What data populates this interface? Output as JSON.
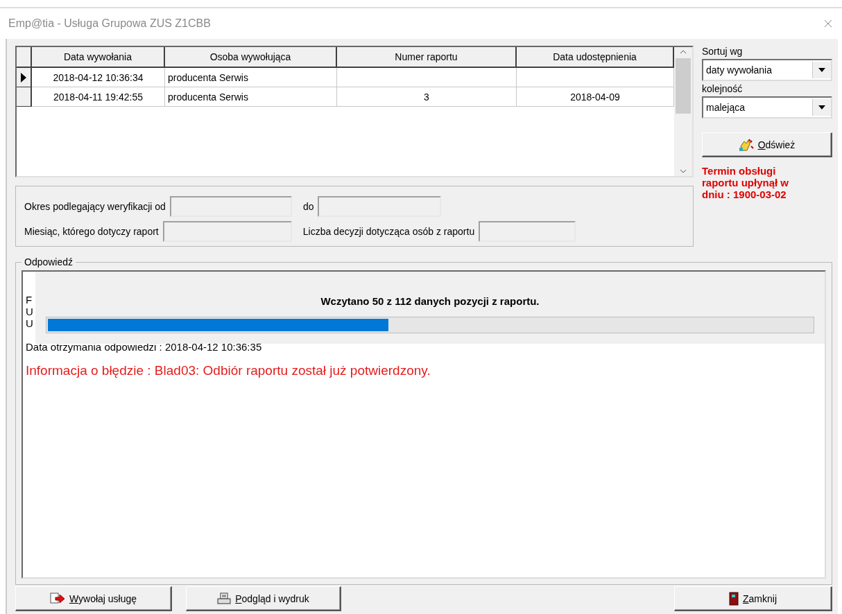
{
  "window": {
    "title": "Emp@tia - Usługa Grupowa ZUS Z1CBB"
  },
  "table": {
    "columns": [
      "Data wywołania",
      "Osoba wywołująca",
      "Numer raportu",
      "Data udostępnienia"
    ],
    "rows": [
      {
        "selected": true,
        "cells": [
          "2018-04-12 10:36:34",
          "producenta Serwis",
          "",
          ""
        ]
      },
      {
        "selected": false,
        "cells": [
          "2018-04-11 19:42:55",
          "producenta Serwis",
          "3",
          "2018-04-09"
        ]
      }
    ]
  },
  "sort": {
    "label": "Sortuj wg",
    "value": "daty wywołania",
    "order_label": "kolejność",
    "order_value": "malejąca"
  },
  "refresh_button": "Odśwież",
  "deadline_warning": "Termin obsługi raportu upłynął w dniu : 1900-03-02",
  "verification": {
    "period_label": "Okres podlegający weryfikacji od",
    "to_label": "do",
    "month_label": "Miesiąc, którego dotyczy raport",
    "decisions_label": "Liczba decyzji dotycząca osób z raportu"
  },
  "response": {
    "title": "Odpowiedź",
    "lines": [
      {
        "kind": "fragment",
        "text": "F"
      },
      {
        "kind": "fragment",
        "text": "U"
      },
      {
        "kind": "fragment",
        "text": "U"
      },
      {
        "kind": "covered"
      },
      {
        "kind": "normal",
        "text": "Data otrzymania odpowiedzi : 2018-04-12 10:36:35"
      },
      {
        "kind": "blank"
      },
      {
        "kind": "error",
        "text": "Informacja o błędzie : Blad03: Odbiór raportu został już potwierdzony."
      }
    ],
    "progress": {
      "message": "Wczytano 50 z 112 danych pozycji z raportu.",
      "level": 0.446
    }
  },
  "buttons": [
    {
      "kind": "invoke",
      "label": "Wywołaj usługę"
    },
    {
      "kind": "preview",
      "label": "Podgląd i wydruk"
    },
    {
      "kind": "close",
      "label": "Zamknij"
    }
  ]
}
